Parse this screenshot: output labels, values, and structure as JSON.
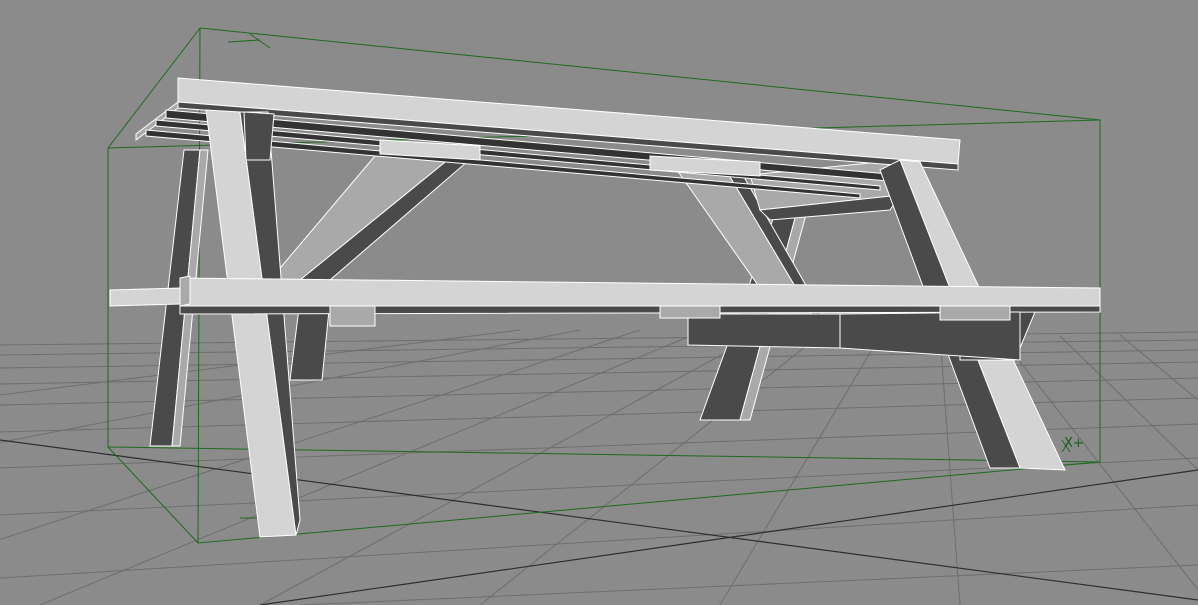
{
  "viewport": {
    "background_color": "#8b8b8b",
    "grid_color": "#6e6e6e",
    "grid_major_color": "#2e2e2e",
    "bbox_color": "#1e6a1e",
    "wire_color": "#ffffff",
    "face_light": "#d4d4d4",
    "face_mid": "#a9a9a9",
    "face_dark": "#4a4a4a",
    "gizmo_label": "X+",
    "selected_object": "picnic-table"
  }
}
